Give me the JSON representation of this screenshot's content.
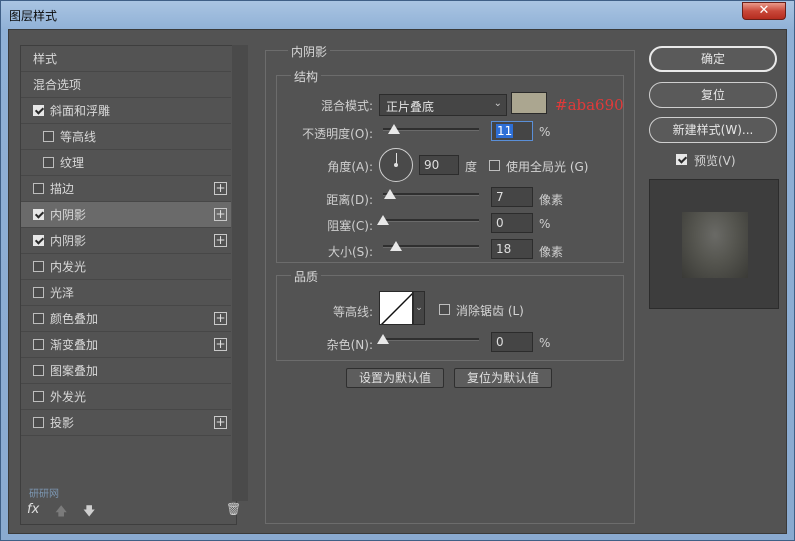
{
  "window": {
    "title": "图层样式",
    "close_glyph": "✕"
  },
  "sidebar": {
    "items": [
      {
        "label": "样式",
        "checkbox": false,
        "checked": false,
        "plus": false,
        "selected": false,
        "indent": 0
      },
      {
        "label": "混合选项",
        "checkbox": false,
        "checked": false,
        "plus": false,
        "selected": false,
        "indent": 0
      },
      {
        "label": "斜面和浮雕",
        "checkbox": true,
        "checked": true,
        "plus": false,
        "selected": false,
        "indent": 0
      },
      {
        "label": "等高线",
        "checkbox": true,
        "checked": false,
        "plus": false,
        "selected": false,
        "indent": 1
      },
      {
        "label": "纹理",
        "checkbox": true,
        "checked": false,
        "plus": false,
        "selected": false,
        "indent": 1
      },
      {
        "label": "描边",
        "checkbox": true,
        "checked": false,
        "plus": true,
        "selected": false,
        "indent": 0
      },
      {
        "label": "内阴影",
        "checkbox": true,
        "checked": true,
        "plus": true,
        "selected": true,
        "indent": 0
      },
      {
        "label": "内阴影",
        "checkbox": true,
        "checked": true,
        "plus": true,
        "selected": false,
        "indent": 0
      },
      {
        "label": "内发光",
        "checkbox": true,
        "checked": false,
        "plus": false,
        "selected": false,
        "indent": 0
      },
      {
        "label": "光泽",
        "checkbox": true,
        "checked": false,
        "plus": false,
        "selected": false,
        "indent": 0
      },
      {
        "label": "颜色叠加",
        "checkbox": true,
        "checked": false,
        "plus": true,
        "selected": false,
        "indent": 0
      },
      {
        "label": "渐变叠加",
        "checkbox": true,
        "checked": false,
        "plus": true,
        "selected": false,
        "indent": 0
      },
      {
        "label": "图案叠加",
        "checkbox": true,
        "checked": false,
        "plus": false,
        "selected": false,
        "indent": 0
      },
      {
        "label": "外发光",
        "checkbox": true,
        "checked": false,
        "plus": false,
        "selected": false,
        "indent": 0
      },
      {
        "label": "投影",
        "checkbox": true,
        "checked": false,
        "plus": true,
        "selected": false,
        "indent": 0
      }
    ],
    "footer": {
      "fx": "fx",
      "up": "🡅",
      "down": "🡇",
      "trash": "🗑",
      "watermark": "研研网"
    }
  },
  "panel": {
    "section_title": "内阴影",
    "structure": {
      "title": "结构",
      "blend_mode_label": "混合模式:",
      "blend_mode_value": "正片叠底",
      "swatch_color": "#aba690",
      "swatch_note": "#aba690",
      "opacity_label": "不透明度(O):",
      "opacity_value": "11",
      "opacity_slider": 11,
      "percent": "%",
      "angle_label": "角度(A):",
      "angle_value": "90",
      "degree_unit": "度",
      "global_light_label": "使用全局光 (G)",
      "global_light_checked": false,
      "distance_label": "距离(D):",
      "distance_value": "7",
      "distance_slider": 7,
      "choke_label": "阻塞(C):",
      "choke_value": "0",
      "choke_slider": 0,
      "size_label": "大小(S):",
      "size_value": "18",
      "size_slider": 18,
      "pixels": "像素"
    },
    "quality": {
      "title": "品质",
      "contour_label": "等高线:",
      "anti_alias_label": "消除锯齿 (L)",
      "anti_alias_checked": false,
      "noise_label": "杂色(N):",
      "noise_value": "0",
      "noise_slider": 0,
      "percent": "%"
    },
    "buttons": {
      "set_default": "设置为默认值",
      "reset_default": "复位为默认值"
    }
  },
  "actions": {
    "ok": "确定",
    "reset": "复位",
    "new_style": "新建样式(W)...",
    "preview_label": "预览(V)",
    "preview_checked": true
  }
}
